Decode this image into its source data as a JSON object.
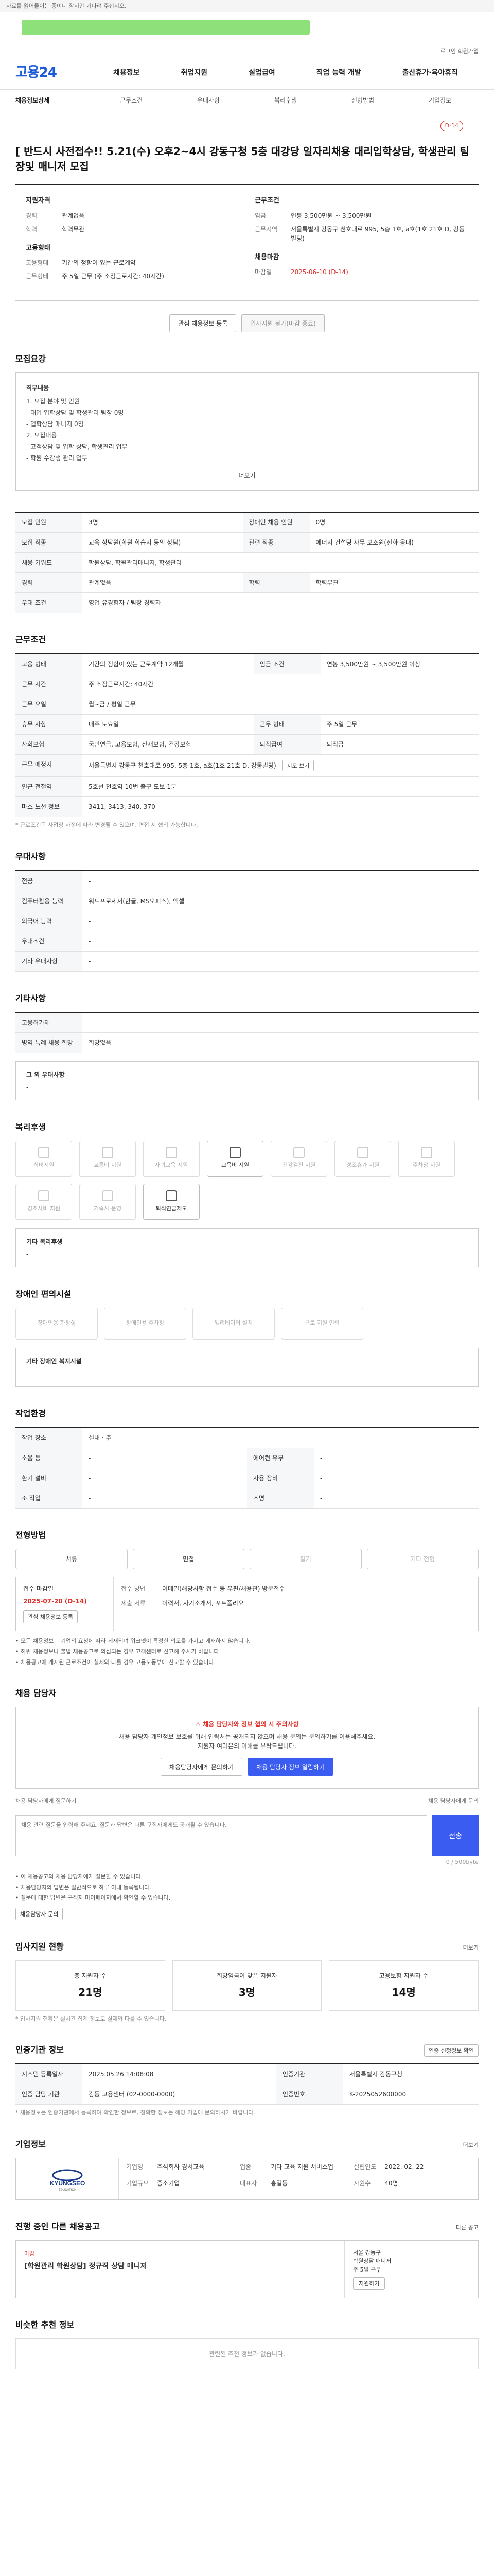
{
  "topbar": {
    "notice": "자료를 읽어들이는 중이니 잠시만 기다려 주십시오."
  },
  "util": {
    "links": "로그인 회원가입"
  },
  "header": {
    "logo": "고용24",
    "nav": [
      "채용정보",
      "취업지원",
      "실업급여",
      "직업 능력 개발",
      "출산휴가·육아휴직"
    ]
  },
  "tabs": {
    "items": [
      "채용정보상세",
      "근무조건",
      "우대사항",
      "복리후생",
      "전형방법",
      "기업정보"
    ],
    "dday": "D-14"
  },
  "job": {
    "title": "[ 반드시 사전접수!! 5.21(수) 오후2~4시 강동구청 5층 대강당 일자리채용 대리입학상담, 학생관리 팀장및 매니저 모집"
  },
  "summary": {
    "left_head": "지원자격",
    "left": [
      {
        "k": "경력",
        "v": "관계없음"
      },
      {
        "k": "학력",
        "v": "학력무관"
      }
    ],
    "left_head2": "고용형태",
    "left2": [
      {
        "k": "고용형태",
        "v": "기간의 정함이 있는 근로계약"
      },
      {
        "k": "근무형태",
        "v": "주 5일 근무 (주 소정근로시간: 40시간)"
      }
    ],
    "right_head": "근무조건",
    "right": [
      {
        "k": "임금",
        "v": "연봉 3,500만원 ~ 3,500만원"
      },
      {
        "k": "근무지역",
        "v": "서울특별시 강동구 천호대로 995, 5층 1호, a호(1호 21호 D, 강동빌딩)"
      }
    ],
    "right_head2": "채용마감",
    "right2": [
      {
        "k": "마감일",
        "v": "2025-06-10 (D-14)"
      }
    ],
    "btn_interest": "관심 채용정보 등록",
    "btn_apply": "입사지원 불가(마감 종료)"
  },
  "detail": {
    "title": "모집요강",
    "head": "직무내용",
    "lines": [
      "1. 모집 분야 및 인원",
      "- 대입 입학상담 및 학생관리 팀장 0명",
      "- 입학상담 매니저 0명",
      "2. 모집내용",
      "- 고객상담 및 입학 상담, 학생관리 업무",
      "- 학원 수강생 관리 업무"
    ],
    "more": "더보기"
  },
  "jobinfo": {
    "rows": [
      {
        "k": "모집 인원",
        "v": "3명",
        "k2": "장애인 채용 인원",
        "v2": "0명"
      },
      {
        "k": "모집 직종",
        "v": "교육 상담원(학원 학습지 등의 상담)",
        "k2": "관련 직종",
        "v2": "에너지 컨설팅 사무 보조원(전화 응대)"
      },
      {
        "k": "채용 키워드",
        "v": "학원상담, 학원관리매니저, 학생관리",
        "k2": "",
        "v2": ""
      },
      {
        "k": "경력",
        "v": "관계없음",
        "k2": "학력",
        "v2": "학력무관"
      },
      {
        "k": "우대 조건",
        "v": "영업 유경험자 / 팀장 경력자",
        "k2": "",
        "v2": ""
      }
    ]
  },
  "work": {
    "title": "근무조건",
    "rows": [
      {
        "k": "고용 형태",
        "v": "기간의 정함이 있는 근로계약 12개월",
        "k2": "임금 조건",
        "v2": "연봉 3,500만원 ~ 3,500만원 이상"
      },
      {
        "k": "근무 시간",
        "v": "주 소정근로시간: 40시간",
        "k2": "",
        "v2": ""
      },
      {
        "k": "근무 요일",
        "v": "월~금 / 평일 근무",
        "k2": "",
        "v2": ""
      },
      {
        "k": "휴무 사항",
        "v": "매주 토요일",
        "k2": "근무 형태",
        "v2": "주 5일 근무"
      },
      {
        "k": "사회보험",
        "v": "국민연금, 고용보험, 산재보험, 건강보험",
        "k2": "퇴직급여",
        "v2": "퇴직금"
      },
      {
        "k": "근무 예정지",
        "v": "서울특별시 강동구 천호대로 995, 5층 1호, a호(1호 21호 D, 강동빌딩)",
        "k2": "",
        "v2": ""
      },
      {
        "k": "인근 전철역",
        "v": "5호선 천호역 10번 출구 도보 1분",
        "k2": "",
        "v2": ""
      },
      {
        "k": "마스 노선 정보",
        "v": "3411, 3413, 340, 370",
        "k2": "",
        "v2": ""
      }
    ],
    "note": "* 근로조건은 사업장 사정에 따라 변경될 수 있으며, 면접 시 협의 가능합니다.",
    "map_btn": "지도 보기"
  },
  "prefer": {
    "title": "우대사항",
    "rows": [
      {
        "k": "전공",
        "v": "-"
      },
      {
        "k": "컴퓨터활용 능력",
        "v": "워드프로세서(한글, MS오피스), 엑셀"
      },
      {
        "k": "외국어 능력",
        "v": "-"
      },
      {
        "k": "우대조건",
        "v": "-"
      },
      {
        "k": "기타 우대사항",
        "v": "-"
      }
    ]
  },
  "etc": {
    "title": "기타사항",
    "rows": [
      {
        "k": "고용허가제",
        "v": "-"
      },
      {
        "k": "병역 특례 채용 희망",
        "v": "희망없음"
      }
    ],
    "extra_head": "그 외 우대사항",
    "extra_val": "-"
  },
  "welfare": {
    "title": "복리후생",
    "cards": [
      {
        "label": "식비지원",
        "on": false
      },
      {
        "label": "교통비 지원",
        "on": false
      },
      {
        "label": "자녀교육 지원",
        "on": false
      },
      {
        "label": "교육비 지원",
        "on": true
      },
      {
        "label": "건강검진 지원",
        "on": false
      },
      {
        "label": "경조휴가 지원",
        "on": false
      },
      {
        "label": "주차장 지원",
        "on": false
      },
      {
        "label": "경조사비 지원",
        "on": false
      },
      {
        "label": "기숙사 운영",
        "on": false
      },
      {
        "label": "퇴직연금제도",
        "on": true
      }
    ],
    "sub_head": "기타 복리후생",
    "sub_val": "-"
  },
  "disabled": {
    "title": "장애인 편의시설",
    "cards": [
      "장애인용 화장실",
      "장애인용 주차장",
      "엘리베이터 설치",
      "근로 지원 인력"
    ],
    "sub_head": "기타 장애인 복지시설",
    "sub_val": "-"
  },
  "env": {
    "title": "작업환경",
    "rows": [
      {
        "k": "작업 장소",
        "v": "실내 · 주",
        "k2": "",
        "v2": ""
      },
      {
        "k": "소음 등",
        "v": "-",
        "k2": "에어컨 유무",
        "v2": "-"
      },
      {
        "k": "환기 설비",
        "v": "-",
        "k2": "사용 장비",
        "v2": "-"
      },
      {
        "k": "조 작업",
        "v": "-",
        "k2": "조명",
        "v2": "-"
      }
    ]
  },
  "apply": {
    "title": "전형방법",
    "methods": [
      {
        "label": "서류",
        "on": true
      },
      {
        "label": "면접",
        "on": true
      },
      {
        "label": "필기",
        "on": false
      },
      {
        "label": "기타 전형",
        "on": false
      }
    ],
    "period_head": "접수 마감일",
    "period_date": "2025-07-20 (D-14)",
    "period_btn": "관심 채용정보 등록",
    "r_rows": [
      {
        "k": "접수 방법",
        "v": "이메일(해당사항 접수 등 우편/채용관) 방문접수"
      },
      {
        "k": "제출 서류",
        "v": "이력서, 자기소개서, 포트폴리오"
      }
    ],
    "bullets": [
      "• 모든 채용정보는 기업의 요청에 따라 게재되며 워크넷이 특정한 의도를 가지고 게재하지 않습니다.",
      "• 허위 채용정보나 불법 채용공고로 의심되는 경우 고객센터로 신고해 주시기 바랍니다.",
      "• 채용공고에 게시된 근로조건이 실제와 다를 경우 고용노동부에 신고할 수 있습니다."
    ]
  },
  "contact": {
    "title": "채용 담당자",
    "warn": "채용 담당자와 정보 협의 시 주의사항",
    "desc1": "채용 담당자 개인정보 보호를 위해 연락처는 공개되지 않으며 채용 문의는 문의하기를 이용해주세요.",
    "desc2": "지원자 여러분의 이해를 부탁드립니다.",
    "btn1": "채용담당자에게 문의하기",
    "btn2": "채용 담당자 정보 열람하기",
    "q_head": "채용 담당자에게 질문하기",
    "q_right": "채용 담당자에게 문의",
    "q_placeholder": "채용 관련 질문을 입력해 주세요. 질문과 답변은 다른 구직자에게도 공개될 수 있습니다.",
    "q_send": "전송",
    "q_count": "0 / 500byte",
    "bullets": [
      "• 이 채용공고의 채용 담당자에게 질문할 수 있습니다.",
      "• 채용담당자의 답변은 일반적으로 하루 이내 등록됩니다.",
      "• 질문에 대한 답변은 구직자 마이페이지에서 확인할 수 있습니다."
    ],
    "inquiry_btn": "채용담당자 문의"
  },
  "status": {
    "title": "입사지원 현황",
    "more": "더보기",
    "items": [
      {
        "label": "총 지원자 수",
        "value": "21명"
      },
      {
        "label": "희망임금이 맞은 지원자",
        "value": "3명"
      },
      {
        "label": "고용보험 지원자 수",
        "value": "14명"
      }
    ],
    "note": "* 입사지원 현황은 실시간 집계 정보로 실제와 다를 수 있습니다."
  },
  "agency": {
    "title": "인증기관 정보",
    "btn": "인증 신청정보 확인",
    "rows": [
      {
        "k": "시스템 등록일자",
        "v": "2025.05.26 14:08:08",
        "k2": "인증기관",
        "v2": "서울특별시 강동구청"
      },
      {
        "k": "인증 담당 기관",
        "v": "강동 고용센터 (02-0000-0000)",
        "k2": "인증번호",
        "v2": "K-2025052600000"
      }
    ],
    "note": "* 채용정보는 인증기관에서 등록하여 확인한 정보로, 정확한 정보는 해당 기업에 문의하시기 바랍니다."
  },
  "company": {
    "title": "기업정보",
    "logo_text": "KYUNGSEO",
    "logo_sub": "EDUCATION",
    "more": "더보기",
    "rows": [
      {
        "k": "기업명",
        "v": "주식회사 경서교육"
      },
      {
        "k": "업종",
        "v": "기타 교육 지원 서비스업"
      },
      {
        "k": "설립연도",
        "v": "2022. 02. 22"
      },
      {
        "k": "기업규모",
        "v": "중소기업"
      },
      {
        "k": "대표자",
        "v": "홍길동"
      },
      {
        "k": "사원수",
        "v": "40명"
      }
    ]
  },
  "others": {
    "title": "진행 중인 다른 채용공고",
    "right_head": "다른 공고",
    "badge": "마감",
    "job_title": "[학원관리 학원상담] 정규직 상담 매니저",
    "r_lines": [
      "서울 강동구",
      "학원상담 매니저",
      "주 5일 근무"
    ],
    "r_btn": "지원하기"
  },
  "recommend": {
    "title": "비슷한 추천 정보",
    "empty": "관련된 추천 정보가 없습니다."
  }
}
